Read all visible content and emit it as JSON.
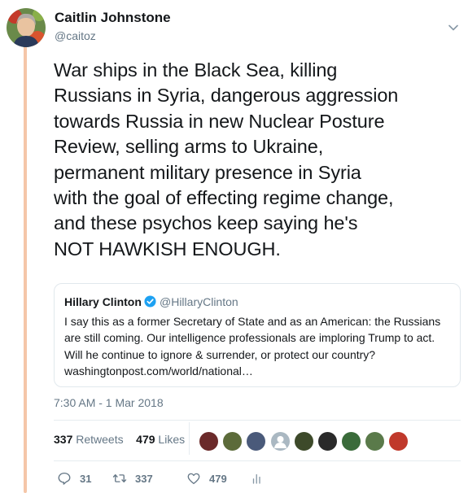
{
  "author": {
    "name": "Caitlin Johnstone",
    "handle": "@caitoz"
  },
  "tweet": {
    "lines": [
      "War ships in the Black Sea, killing",
      "Russians in Syria, dangerous aggression",
      "towards Russia in new Nuclear Posture",
      "Review, selling arms to Ukraine,",
      "permanent military presence in Syria",
      "with the goal of effecting regime change,",
      "and these psychos keep saying he's",
      "NOT HAWKISH ENOUGH."
    ]
  },
  "quoted": {
    "name": "Hillary Clinton",
    "handle": "@HillaryClinton",
    "lines": [
      "I say this as a former Secretary of State and as an American: the Russians",
      "are still coming. Our intelligence professionals are imploring Trump to act.",
      "Will he continue to ignore & surrender, or protect our country?",
      "washingtonpost.com/world/national…"
    ]
  },
  "timestamp": "7:30 AM - 1 Mar 2018",
  "stats": {
    "retweets_count": "337",
    "retweets_label": "Retweets",
    "likes_count": "479",
    "likes_label": "Likes"
  },
  "actions": {
    "replies": "31",
    "retweets": "337",
    "likes": "479"
  },
  "colors": {
    "thread_line": "#f5c6a8",
    "muted": "#657786",
    "verified": "#1da1f2"
  },
  "liker_avatars": [
    "#6b2a2a",
    "#5c6b3a",
    "#4a5a7a",
    "#aab8c2",
    "#3d4a2a",
    "#2a2a2a",
    "#3a6b3a",
    "#5a7a4a",
    "#c0392b"
  ]
}
